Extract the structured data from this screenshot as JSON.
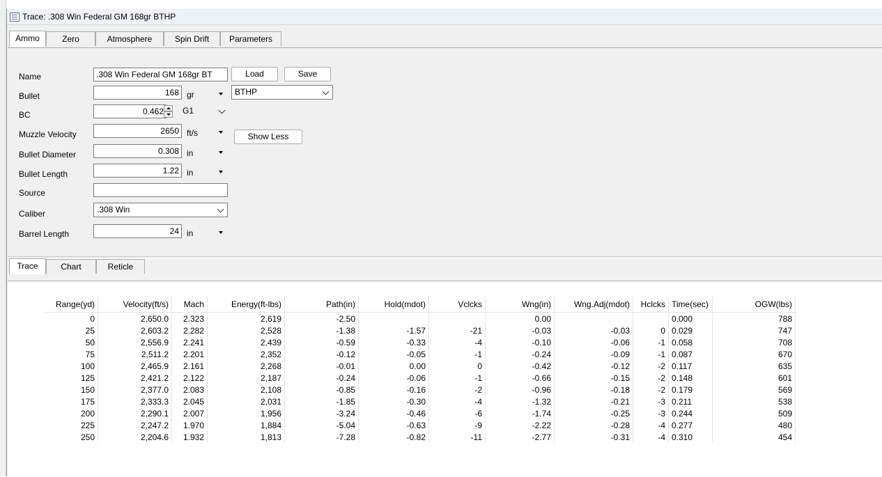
{
  "window": {
    "title": "Trace: .308 Win Federal GM 168gr BTHP"
  },
  "top_tabs": [
    "Ammo",
    "Zero",
    "Atmosphere",
    "Spin Drift",
    "Parameters"
  ],
  "ammo": {
    "name_label": "Name",
    "name_value": ".308 Win Federal GM 168gr BT",
    "load_label": "Load",
    "save_label": "Save",
    "bullet_label": "Bullet",
    "bullet_value": "168",
    "bullet_unit": "gr",
    "bullet_type": "BTHP",
    "bc_label": "BC",
    "bc_value": "0.462",
    "bc_model": "G1",
    "mv_label": "Muzzle Velocity",
    "mv_value": "2650",
    "mv_unit": "ft/s",
    "show_less_label": "Show Less",
    "diameter_label": "Bullet Diameter",
    "diameter_value": "0.308",
    "diameter_unit": "in",
    "length_label": "Bullet Length",
    "length_value": "1.22",
    "length_unit": "in",
    "source_label": "Source",
    "source_value": "",
    "caliber_label": "Caliber",
    "caliber_value": ".308 Win",
    "barrel_label": "Barrel Length",
    "barrel_value": "24",
    "barrel_unit": "in"
  },
  "bottom_tabs": [
    "Trace",
    "Chart",
    "Reticle"
  ],
  "trace": {
    "headers": [
      "Range(yd)",
      "Velocity(ft/s)",
      "Mach",
      "Energy(ft-lbs)",
      "Path(in)",
      "Hold(mdot)",
      "Vclcks",
      "Wng(in)",
      "Wng.Adj(mdot)",
      "Hclcks",
      "Time(sec)",
      "OGW(lbs)"
    ],
    "rows": [
      [
        "0",
        "2,650.0",
        "2.323",
        "2,619",
        "-2.50",
        "",
        "",
        "0.00",
        "",
        "",
        "0.000",
        "788"
      ],
      [
        "25",
        "2,603.2",
        "2.282",
        "2,528",
        "-1.38",
        "-1.57",
        "-21",
        "-0.03",
        "-0.03",
        "0",
        "0.029",
        "747"
      ],
      [
        "50",
        "2,556.9",
        "2.241",
        "2,439",
        "-0.59",
        "-0.33",
        "-4",
        "-0.10",
        "-0.06",
        "-1",
        "0.058",
        "708"
      ],
      [
        "75",
        "2,511.2",
        "2.201",
        "2,352",
        "-0.12",
        "-0.05",
        "-1",
        "-0.24",
        "-0.09",
        "-1",
        "0.087",
        "670"
      ],
      [
        "100",
        "2,465.9",
        "2.161",
        "2,268",
        "-0.01",
        "0.00",
        "0",
        "-0.42",
        "-0.12",
        "-2",
        "0.117",
        "635"
      ],
      [
        "125",
        "2,421.2",
        "2.122",
        "2,187",
        "-0.24",
        "-0.06",
        "-1",
        "-0.66",
        "-0.15",
        "-2",
        "0.148",
        "601"
      ],
      [
        "150",
        "2,377.0",
        "2.083",
        "2,108",
        "-0.85",
        "-0.16",
        "-2",
        "-0.96",
        "-0.18",
        "-2",
        "0.179",
        "569"
      ],
      [
        "175",
        "2,333.3",
        "2.045",
        "2,031",
        "-1.85",
        "-0.30",
        "-4",
        "-1.32",
        "-0.21",
        "-3",
        "0.211",
        "538"
      ],
      [
        "200",
        "2,290.1",
        "2.007",
        "1,956",
        "-3.24",
        "-0.46",
        "-6",
        "-1.74",
        "-0.25",
        "-3",
        "0.244",
        "509"
      ],
      [
        "225",
        "2,247.2",
        "1.970",
        "1,884",
        "-5.04",
        "-0.63",
        "-9",
        "-2.22",
        "-0.28",
        "-4",
        "0.277",
        "480"
      ],
      [
        "250",
        "2,204.6",
        "1.932",
        "1,813",
        "-7.28",
        "-0.82",
        "-11",
        "-2.77",
        "-0.31",
        "-4",
        "0.310",
        "454"
      ]
    ]
  }
}
